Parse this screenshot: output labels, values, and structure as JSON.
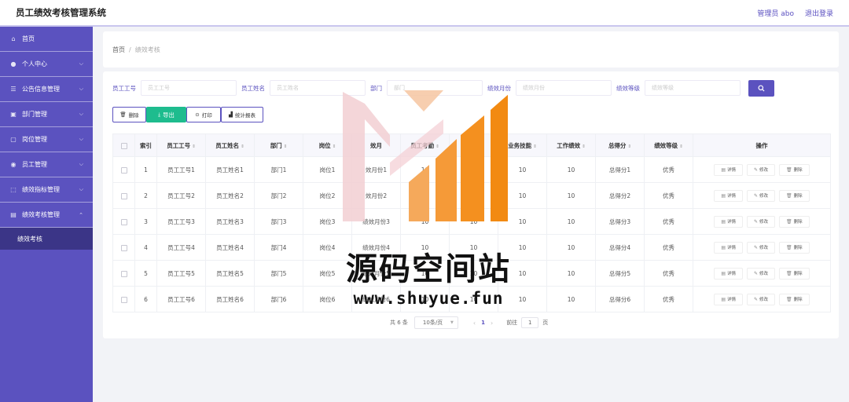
{
  "app": {
    "title": "员工绩效考核管理系统"
  },
  "header": {
    "user_label": "管理员 abo",
    "logout_label": "退出登录"
  },
  "sidebar": {
    "items": [
      {
        "label": "首页",
        "icon": "home-icon",
        "chevron": false
      },
      {
        "label": "个人中心",
        "icon": "user-icon",
        "chevron": true
      },
      {
        "label": "公告信息管理",
        "icon": "notice-icon",
        "chevron": true
      },
      {
        "label": "部门管理",
        "icon": "department-icon",
        "chevron": true
      },
      {
        "label": "岗位管理",
        "icon": "position-icon",
        "chevron": true
      },
      {
        "label": "员工管理",
        "icon": "employee-icon",
        "chevron": true
      },
      {
        "label": "绩效指标管理",
        "icon": "indicator-icon",
        "chevron": true
      },
      {
        "label": "绩效考核管理",
        "icon": "assessment-icon",
        "chevron": true
      }
    ],
    "sub_item": "绩效考核"
  },
  "breadcrumb": {
    "home": "首页",
    "separator": "/",
    "current": "绩效考核"
  },
  "search": {
    "fields": [
      {
        "label": "员工工号",
        "placeholder": "员工工号"
      },
      {
        "label": "员工姓名",
        "placeholder": "员工姓名"
      },
      {
        "label": "部门",
        "placeholder": "部门"
      },
      {
        "label": "绩效月份",
        "placeholder": "绩效月份"
      },
      {
        "label": "绩效等级",
        "placeholder": "绩效等级"
      }
    ]
  },
  "toolbar": {
    "delete_label": "删除",
    "export_label": "导出",
    "print_label": "打印",
    "stats_label": "统计报表"
  },
  "table": {
    "headers": [
      "",
      "索引",
      "员工工号",
      "员工姓名",
      "部门",
      "岗位",
      "绩效月份",
      "员工考勤",
      "工作态度",
      "业务技能",
      "工作绩效",
      "总得分",
      "绩效等级",
      "操作"
    ],
    "header_display": [
      "",
      "索引",
      "员工工号",
      "员工姓名",
      "部门",
      "岗位",
      "效月",
      "员工考勤",
      "态",
      "业务技能",
      "工作绩效",
      "总得分",
      "绩效等级",
      "操作"
    ],
    "rows": [
      {
        "index": "1",
        "emp_no": "员工工号1",
        "emp_name": "员工姓名1",
        "dept": "部门1",
        "post": "岗位1",
        "month": "效月份1",
        "attendance": "10",
        "attitude": "10",
        "skill": "10",
        "performance": "10",
        "total": "总得分1",
        "level": "优秀"
      },
      {
        "index": "2",
        "emp_no": "员工工号2",
        "emp_name": "员工姓名2",
        "dept": "部门2",
        "post": "岗位2",
        "month": "效月份2",
        "attendance": "10",
        "attitude": "10",
        "skill": "10",
        "performance": "10",
        "total": "总得分2",
        "level": "优秀"
      },
      {
        "index": "3",
        "emp_no": "员工工号3",
        "emp_name": "员工姓名3",
        "dept": "部门3",
        "post": "岗位3",
        "month": "绩效月份3",
        "attendance": "10",
        "attitude": "10",
        "skill": "10",
        "performance": "10",
        "total": "总得分3",
        "level": "优秀"
      },
      {
        "index": "4",
        "emp_no": "员工工号4",
        "emp_name": "员工姓名4",
        "dept": "部门4",
        "post": "岗位4",
        "month": "绩效月份4",
        "attendance": "10",
        "attitude": "10",
        "skill": "10",
        "performance": "10",
        "total": "总得分4",
        "level": "优秀"
      },
      {
        "index": "5",
        "emp_no": "员工工号5",
        "emp_name": "员工姓名5",
        "dept": "部门5",
        "post": "岗位5",
        "month": "绩效月份5",
        "attendance": "10",
        "attitude": "10",
        "skill": "10",
        "performance": "10",
        "total": "总得分5",
        "level": "优秀"
      },
      {
        "index": "6",
        "emp_no": "员工工号6",
        "emp_name": "员工姓名6",
        "dept": "部门6",
        "post": "岗位6",
        "month": "绩效月份6",
        "attendance": "10",
        "attitude": "10",
        "skill": "10",
        "performance": "10",
        "total": "总得分6",
        "level": "优秀"
      }
    ],
    "ops": {
      "detail": "详情",
      "edit": "修改",
      "delete": "删除"
    }
  },
  "pagination": {
    "total_text": "共 6 条",
    "page_size": "10条/页",
    "current_page": "1",
    "goto_label": "前往",
    "goto_value": "1",
    "page_suffix": "页"
  },
  "watermark": {
    "title": "源码空间站",
    "url": "www.shuyue.fun"
  },
  "colors": {
    "brand": "#5b52bf",
    "sidebar_active": "#3b3587",
    "export": "#1ebc8e",
    "logo_orange": "#f28a12",
    "logo_pink": "#f2cfd2"
  }
}
